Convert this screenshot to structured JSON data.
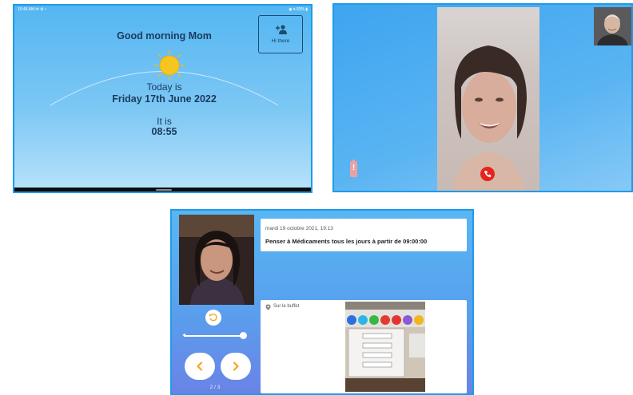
{
  "home_screen": {
    "status_left": "10:45 AM ✉ ⚙ •",
    "status_right": "◉ ▾ 93% ▮",
    "greeting": "Good morning Mom",
    "hi_button_label": "Hi there",
    "hi_button_icon": "people-icon",
    "today_label": "Today is",
    "date": "Friday 17th June 2022",
    "time_label": "It is",
    "time": "08:55",
    "colors": {
      "text": "#1a3a5c",
      "sun": "#f7c520",
      "border": "#1f9be8"
    }
  },
  "video_call": {
    "hangup_icon": "phone-hangup-icon",
    "battery_icon": "battery-low-icon",
    "colors": {
      "hangup": "#e8231d",
      "battery": "#e9a1a4"
    }
  },
  "reminder_screen": {
    "date": "mardi 19 octobre 2021, 19:13",
    "message": "Penser à  Médicaments  tous les jours à partir de 09:00:00",
    "location": "Sur le buffet",
    "pager": "2 / 3",
    "rotate_icon": "rotate-camera-icon",
    "prev_icon": "chevron-left-icon",
    "next_icon": "chevron-right-icon",
    "volume_level": 0.95,
    "colors": {
      "nav_icon": "#f5a623"
    }
  }
}
